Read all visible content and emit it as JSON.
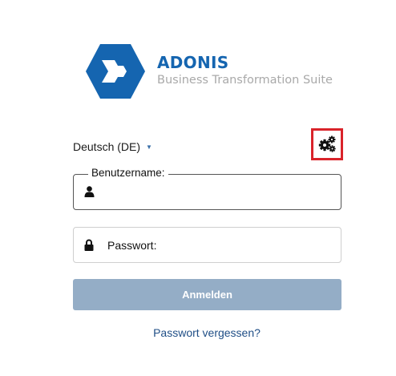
{
  "brand": {
    "name": "ADONIS",
    "tagline": "Business Transformation Suite",
    "accent_color": "#1565b0"
  },
  "language": {
    "selected": "Deutsch (DE)",
    "caret_icon": "caret-down-icon"
  },
  "settings": {
    "icon": "gears-icon",
    "highlight_color": "#d9232a"
  },
  "username": {
    "label": "Benutzername:",
    "value": "",
    "icon": "user-icon"
  },
  "password": {
    "label": "Passwort:",
    "value": "",
    "icon": "lock-icon"
  },
  "login": {
    "label": "Anmelden",
    "color": "#94adc6"
  },
  "forgot_password": {
    "label": "Passwort vergessen?"
  }
}
